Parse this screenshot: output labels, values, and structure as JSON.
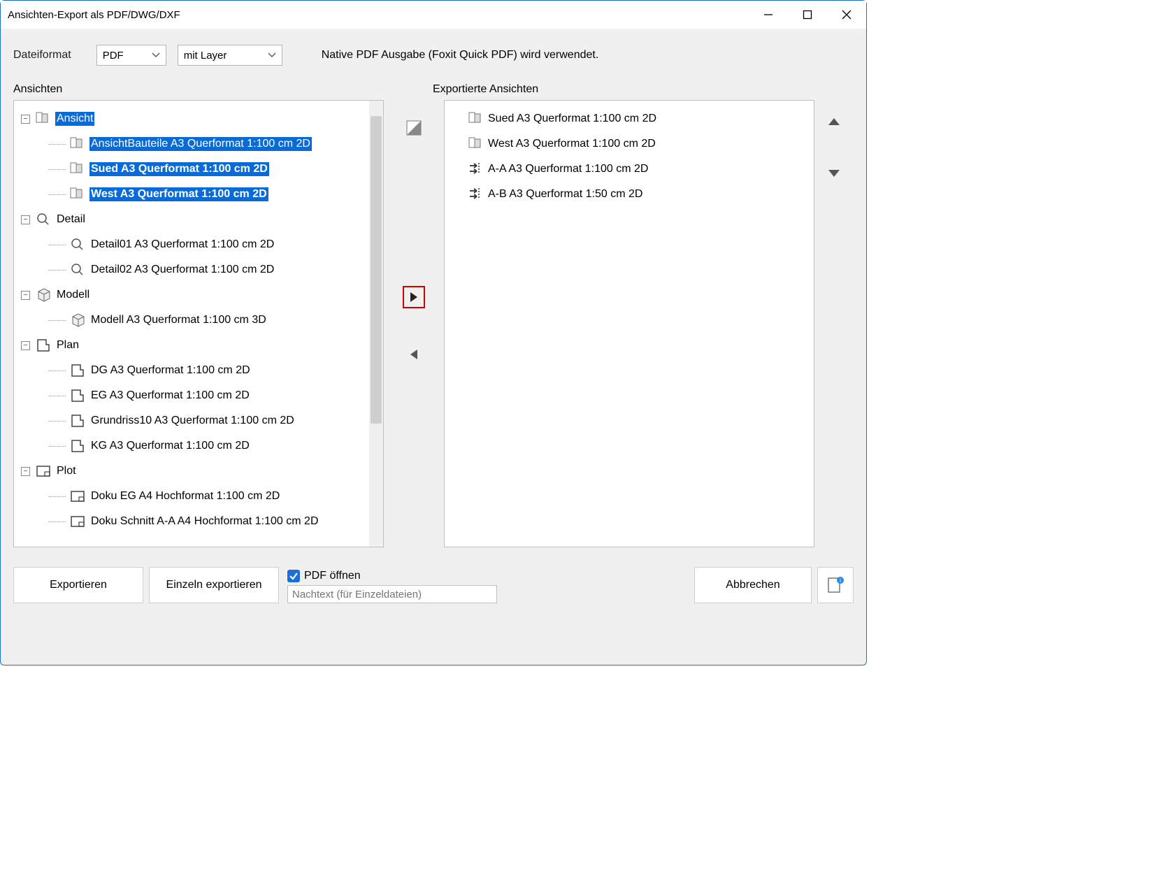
{
  "title": "Ansichten-Export als PDF/DWG/DXF",
  "format": {
    "label": "Dateiformat",
    "file_format": "PDF",
    "layer_option": "mit Layer",
    "native_msg": "Native PDF Ausgabe (Foxit Quick PDF) wird verwendet."
  },
  "labels": {
    "left": "Ansichten",
    "right": "Exportierte Ansichten"
  },
  "tree": {
    "ansicht": {
      "label": "Ansicht",
      "children": [
        "AnsichtBauteile A3 Querformat 1:100 cm 2D",
        "Sued A3 Querformat 1:100 cm 2D",
        "West A3 Querformat 1:100 cm 2D"
      ]
    },
    "detail": {
      "label": "Detail",
      "children": [
        "Detail01 A3 Querformat 1:100 cm 2D",
        "Detail02 A3 Querformat 1:100 cm 2D"
      ]
    },
    "modell": {
      "label": "Modell",
      "children": [
        "Modell A3 Querformat 1:100 cm 3D"
      ]
    },
    "plan": {
      "label": "Plan",
      "children": [
        "DG A3 Querformat 1:100 cm 2D",
        "EG A3 Querformat 1:100 cm 2D",
        "Grundriss10 A3 Querformat 1:100 cm 2D",
        "KG A3 Querformat 1:100 cm 2D"
      ]
    },
    "plot": {
      "label": "Plot",
      "children": [
        "Doku EG A4 Hochformat 1:100 cm 2D",
        "Doku Schnitt A-A A4 Hochformat 1:100 cm 2D"
      ]
    }
  },
  "exported": [
    "Sued A3 Querformat 1:100 cm 2D",
    "West A3 Querformat 1:100 cm 2D",
    "A-A A3 Querformat 1:100 cm 2D",
    "A-B A3 Querformat 1:50 cm 2D"
  ],
  "bottom": {
    "export": "Exportieren",
    "export_single": "Einzeln exportieren",
    "open_pdf": "PDF öffnen",
    "suffix_placeholder": "Nachtext (für Einzeldateien)",
    "cancel": "Abbrechen"
  }
}
